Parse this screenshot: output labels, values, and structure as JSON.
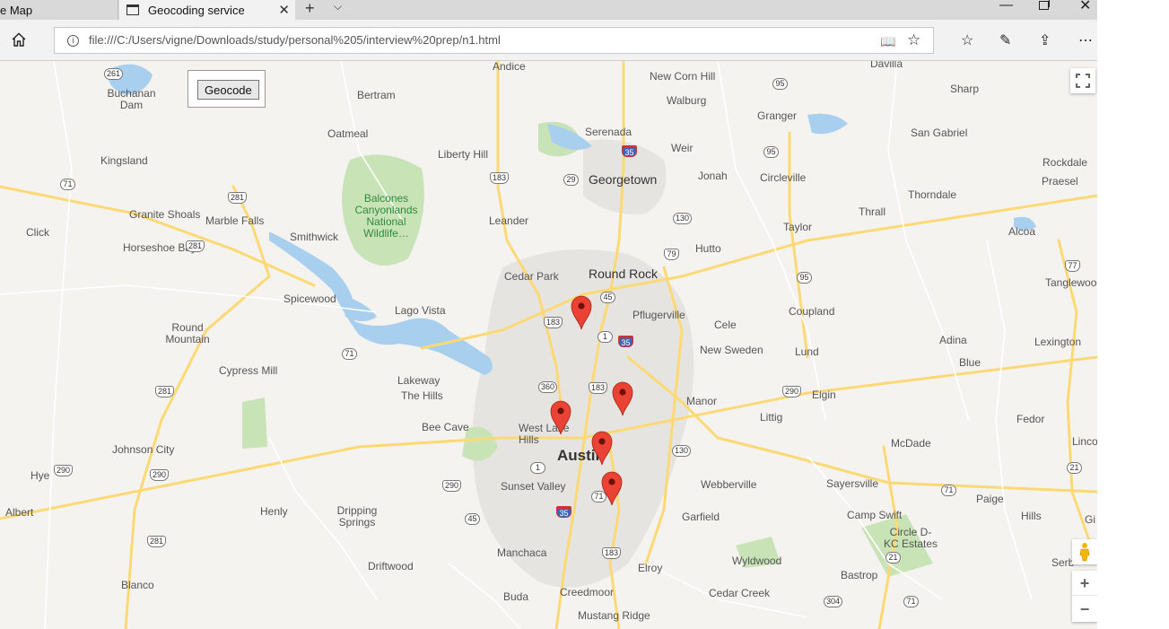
{
  "tabs": [
    {
      "title": "e Map"
    },
    {
      "title": "Geocoding service"
    }
  ],
  "address": "file:///C:/Users/vigne/Downloads/study/personal%205/interview%20prep/n1.html",
  "geocode_button": "Geocode",
  "zoom": {
    "in": "+",
    "out": "−"
  },
  "colors": {
    "marker": "#ea4335",
    "water": "#a8d0ee",
    "park": "#c8e3b6",
    "highway": "#fcd974",
    "road": "#ffffff"
  },
  "places": [
    {
      "name": "Andice"
    },
    {
      "name": "Davilla"
    },
    {
      "name": "Buchanan Dam"
    },
    {
      "name": "Bertram"
    },
    {
      "name": "New Corn Hill"
    },
    {
      "name": "Sharp"
    },
    {
      "name": "Walburg"
    },
    {
      "name": "Oatmeal"
    },
    {
      "name": "Serenada"
    },
    {
      "name": "Granger"
    },
    {
      "name": "San Gabriel"
    },
    {
      "name": "Weir"
    },
    {
      "name": "Kingsland"
    },
    {
      "name": "Liberty Hill"
    },
    {
      "name": "Georgetown"
    },
    {
      "name": "Jonah"
    },
    {
      "name": "Circleville"
    },
    {
      "name": "Rockdale"
    },
    {
      "name": "Praesel"
    },
    {
      "name": "Thorndale"
    },
    {
      "name": "Granite Shoals"
    },
    {
      "name": "Marble Falls"
    },
    {
      "name": "Leander"
    },
    {
      "name": "Thrall"
    },
    {
      "name": "Click"
    },
    {
      "name": "Smithwick"
    },
    {
      "name": "Taylor"
    },
    {
      "name": "Alcoa"
    },
    {
      "name": "Horseshoe Bay"
    },
    {
      "name": "Hutto"
    },
    {
      "name": "Cedar Park"
    },
    {
      "name": "Round Rock"
    },
    {
      "name": "Tanglewood"
    },
    {
      "name": "Spicewood"
    },
    {
      "name": "Lago Vista"
    },
    {
      "name": "Pflugerville"
    },
    {
      "name": "Coupland"
    },
    {
      "name": "Cele"
    },
    {
      "name": "Round Mountain"
    },
    {
      "name": "New Sweden"
    },
    {
      "name": "Adina"
    },
    {
      "name": "Lexington"
    },
    {
      "name": "Lund"
    },
    {
      "name": "Blue"
    },
    {
      "name": "Cypress Mill"
    },
    {
      "name": "Lakeway"
    },
    {
      "name": "The Hills"
    },
    {
      "name": "Manor"
    },
    {
      "name": "Elgin"
    },
    {
      "name": "Littig"
    },
    {
      "name": "Fedor"
    },
    {
      "name": "West Lake Hills"
    },
    {
      "name": "Bee Cave"
    },
    {
      "name": "Johnson City"
    },
    {
      "name": "McDade"
    },
    {
      "name": "Linco"
    },
    {
      "name": "Austin"
    },
    {
      "name": "Hye"
    },
    {
      "name": "Sayersville"
    },
    {
      "name": "Webberville"
    },
    {
      "name": "Sunset Valley"
    },
    {
      "name": "Paige"
    },
    {
      "name": "Albert"
    },
    {
      "name": "Henly"
    },
    {
      "name": "Dripping Springs"
    },
    {
      "name": "Garfield"
    },
    {
      "name": "Camp Swift"
    },
    {
      "name": "Hills"
    },
    {
      "name": "Gi"
    },
    {
      "name": "Circle D-KC Estates"
    },
    {
      "name": "Manchaca"
    },
    {
      "name": "Serb"
    },
    {
      "name": "Driftwood"
    },
    {
      "name": "Wyldwood"
    },
    {
      "name": "Elroy"
    },
    {
      "name": "Bastrop"
    },
    {
      "name": "Blanco"
    },
    {
      "name": "Creedmoor"
    },
    {
      "name": "Cedar Creek"
    },
    {
      "name": "Buda"
    },
    {
      "name": "Mustang Ridge"
    }
  ],
  "park_label": "Balcones Canyonlands National Wildlife…",
  "shields": [
    "261",
    "95",
    "95",
    "281",
    "71",
    "183",
    "29",
    "35",
    "130",
    "95",
    "79",
    "281",
    "77",
    "183",
    "45",
    "35",
    "1",
    "71",
    "360",
    "183",
    "290",
    "281",
    "290",
    "130",
    "1",
    "290",
    "290",
    "71",
    "45",
    "35",
    "183",
    "21",
    "281",
    "21",
    "71",
    "304",
    "71"
  ],
  "markers": [
    {
      "id": "north"
    },
    {
      "id": "east"
    },
    {
      "id": "west"
    },
    {
      "id": "central"
    },
    {
      "id": "south"
    }
  ]
}
